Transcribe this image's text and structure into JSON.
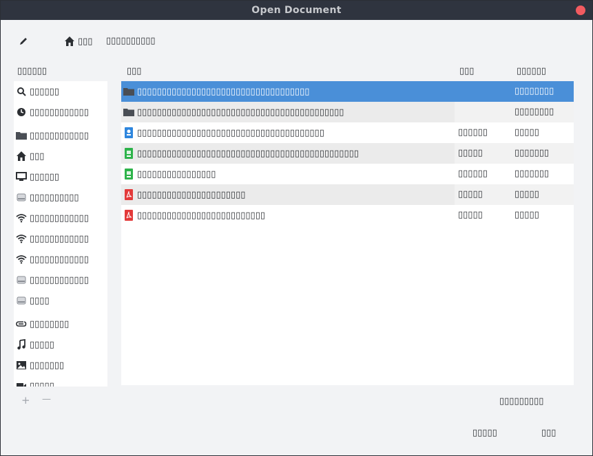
{
  "window": {
    "title": "Open Document"
  },
  "toolbar": {
    "edit_icon": "pencil-icon",
    "breadcrumb": [
      {
        "label": "▯▯▯",
        "icon": "home-icon"
      },
      {
        "label": "▯▯▯▯▯▯▯▯▯▯"
      }
    ]
  },
  "sidebar": {
    "header": "▯▯▯▯▯▯",
    "items": [
      {
        "label": "▯▯▯▯▯▯",
        "icon": "search-icon"
      },
      {
        "label": "▯▯▯▯▯▯▯▯▯▯▯▯",
        "icon": "clock-icon"
      },
      {
        "label": "▯▯▯▯▯▯▯▯▯▯▯▯",
        "icon": "folder-icon"
      },
      {
        "label": "▯▯▯",
        "icon": "home-icon"
      },
      {
        "label": "▯▯▯▯▯▯",
        "icon": "desktop-icon"
      },
      {
        "label": "▯▯▯▯▯▯▯▯▯▯",
        "icon": "drive-icon"
      },
      {
        "label": "▯▯▯▯▯▯▯▯▯▯▯▯",
        "icon": "wifi-icon"
      },
      {
        "label": "▯▯▯▯▯▯▯▯▯▯▯▯",
        "icon": "wifi-icon"
      },
      {
        "label": "▯▯▯▯▯▯▯▯▯▯▯▯",
        "icon": "wifi-icon"
      },
      {
        "label": "▯▯▯▯▯▯▯▯▯▯▯▯",
        "icon": "drive-icon"
      },
      {
        "label": "▯▯▯▯",
        "icon": "drive-icon"
      },
      {
        "label": "▯▯▯▯▯▯▯▯",
        "icon": "paperclip-icon"
      },
      {
        "label": "▯▯▯▯▯",
        "icon": "music-icon"
      },
      {
        "label": "▯▯▯▯▯▯▯",
        "icon": "image-icon"
      },
      {
        "label": "▯▯▯▯▯",
        "icon": "video-icon"
      }
    ],
    "add_label": "+",
    "remove_label": "—"
  },
  "file_list": {
    "columns": {
      "name": "▯▯▯",
      "size": "▯▯▯",
      "modified": "▯▯▯▯▯▯"
    },
    "rows": [
      {
        "name": "▯▯▯▯▯▯▯▯▯▯▯▯▯▯▯▯▯▯▯▯▯▯▯▯▯▯▯▯▯▯▯▯▯▯▯",
        "size": "",
        "modified": "▯▯▯▯▯▯▯▯",
        "icon": "folder-icon",
        "selected": true
      },
      {
        "name": "▯▯▯▯▯▯▯▯▯▯▯▯▯▯▯▯▯▯▯▯▯▯▯▯▯▯▯▯▯▯▯▯▯▯▯▯▯▯▯▯▯▯",
        "size": "",
        "modified": "▯▯▯▯▯▯▯▯",
        "icon": "folder-icon"
      },
      {
        "name": "▯▯▯▯▯▯▯▯▯▯▯▯▯▯▯▯▯▯▯▯▯▯▯▯▯▯▯▯▯▯▯▯▯▯▯▯▯▯",
        "size": "▯▯▯▯▯▯",
        "modified": "▯▯▯▯▯",
        "icon": "blue-document-icon"
      },
      {
        "name": "▯▯▯▯▯▯▯▯▯▯▯▯▯▯▯▯▯▯▯▯▯▯▯▯▯▯▯▯▯▯▯▯▯▯▯▯▯▯▯▯▯▯▯▯▯",
        "size": "▯▯▯▯▯",
        "modified": "▯▯▯▯▯▯▯",
        "icon": "green-document-icon"
      },
      {
        "name": "▯▯▯▯▯▯▯▯▯▯▯▯▯▯▯▯",
        "size": "▯▯▯▯▯▯",
        "modified": "▯▯▯▯▯▯▯",
        "icon": "green-document-icon"
      },
      {
        "name": "▯▯▯▯▯▯▯▯▯▯▯▯▯▯▯▯▯▯▯▯▯▯",
        "size": "▯▯▯▯▯",
        "modified": "▯▯▯▯▯",
        "icon": "pdf-icon"
      },
      {
        "name": "▯▯▯▯▯▯▯▯▯▯▯▯▯▯▯▯▯▯▯▯▯▯▯▯▯▯",
        "size": "▯▯▯▯▯",
        "modified": "▯▯▯▯▯",
        "icon": "pdf-icon"
      }
    ]
  },
  "footer": {
    "filter_label": "▯▯▯▯▯▯▯▯▯",
    "cancel_label": "▯▯▯▯▯",
    "open_label": "▯▯▯"
  },
  "colors": {
    "titlebar": "#2f343f",
    "close": "#f25b60",
    "selection": "#4a8fd8",
    "folder": "#4a4e55",
    "pdf": "#e33a3a",
    "blue_doc": "#2e86de",
    "green_doc": "#2db34a"
  }
}
